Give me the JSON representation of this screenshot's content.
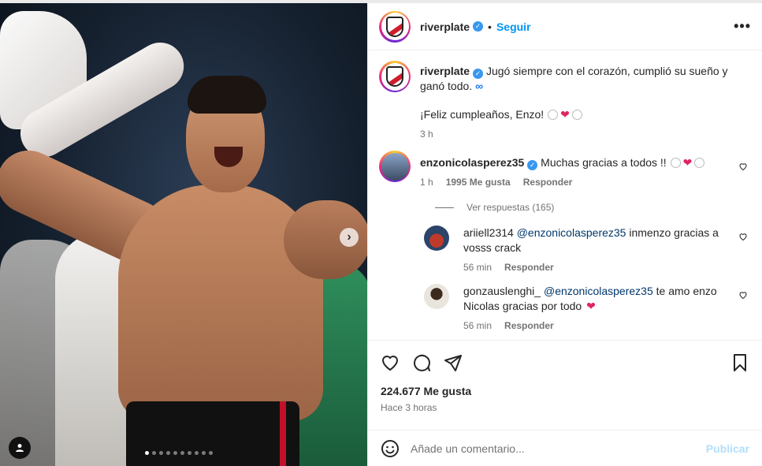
{
  "post_account": {
    "username": "riverplate",
    "verified_mark": "✓",
    "follow_label": "Seguir",
    "more_label": "•••"
  },
  "caption": {
    "username": "riverplate",
    "text": "Jugó siempre con el corazón, cumplió su sueño y ganó todo.",
    "infinity": "∞",
    "line2": "¡Feliz cumpleaños, Enzo!",
    "time": "3 h"
  },
  "comments": [
    {
      "username": "enzonicolasperez35",
      "text": "Muchas gracias a todos !!",
      "time": "1 h",
      "likes": "1995 Me gusta",
      "reply_label": "Responder"
    }
  ],
  "view_replies": "Ver respuestas (165)",
  "replies": [
    {
      "username": "ariiell2314",
      "mention": "@enzonicolasperez35",
      "text": "inmenzo gracias a vosss crack",
      "time": "56 min",
      "reply_label": "Responder"
    },
    {
      "username": "gonzauslenghi_",
      "mention": "@enzonicolasperez35",
      "text": "te amo enzo Nicolas gracias por todo",
      "time": "56 min",
      "reply_label": "Responder"
    }
  ],
  "actions": {
    "likes": "224.677 Me gusta",
    "time": "Hace 3 horas"
  },
  "add_comment": {
    "placeholder": "Añade un comentario...",
    "post_label": "Publicar"
  },
  "carousel": {
    "dots_count": 10,
    "active_index": 0
  },
  "colors": {
    "accent": "#0095f6",
    "heart": "#e0245e",
    "verified": "#3897f0"
  }
}
